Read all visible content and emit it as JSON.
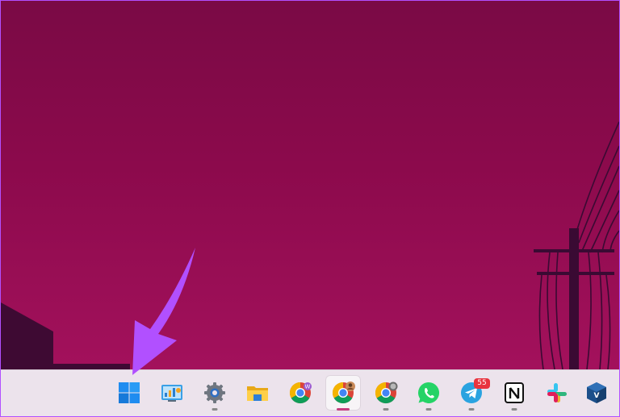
{
  "colors": {
    "wallpaper_top": "#7a0a45",
    "wallpaper_bottom": "#a3115c",
    "taskbar": "#ece3ec",
    "pointer_arrow": "#b150ff",
    "frame_border": "#b150ff"
  },
  "pointer": {
    "target": "start-button",
    "icon": "arrow-pointer"
  },
  "taskbar": {
    "items": [
      {
        "name": "start-button",
        "icon": "windows-logo-icon",
        "running": false
      },
      {
        "name": "desktop-app",
        "icon": "control-panel-icon",
        "running": false
      },
      {
        "name": "settings",
        "icon": "gear-icon",
        "running": true
      },
      {
        "name": "file-explorer",
        "icon": "folder-icon",
        "running": false
      },
      {
        "name": "chrome-profile-w",
        "icon": "chrome-icon",
        "running": false
      },
      {
        "name": "chrome-profile-photo",
        "icon": "chrome-icon",
        "running": true,
        "active": true
      },
      {
        "name": "chrome-profile-globe",
        "icon": "chrome-icon",
        "running": true
      },
      {
        "name": "whatsapp",
        "icon": "whatsapp-icon",
        "running": true
      },
      {
        "name": "telegram",
        "icon": "telegram-icon",
        "running": true,
        "badge": "55"
      },
      {
        "name": "notion",
        "icon": "notion-icon",
        "running": true
      },
      {
        "name": "slack",
        "icon": "slack-icon",
        "running": false
      },
      {
        "name": "virtualbox",
        "icon": "virtualbox-icon",
        "running": false
      }
    ]
  }
}
